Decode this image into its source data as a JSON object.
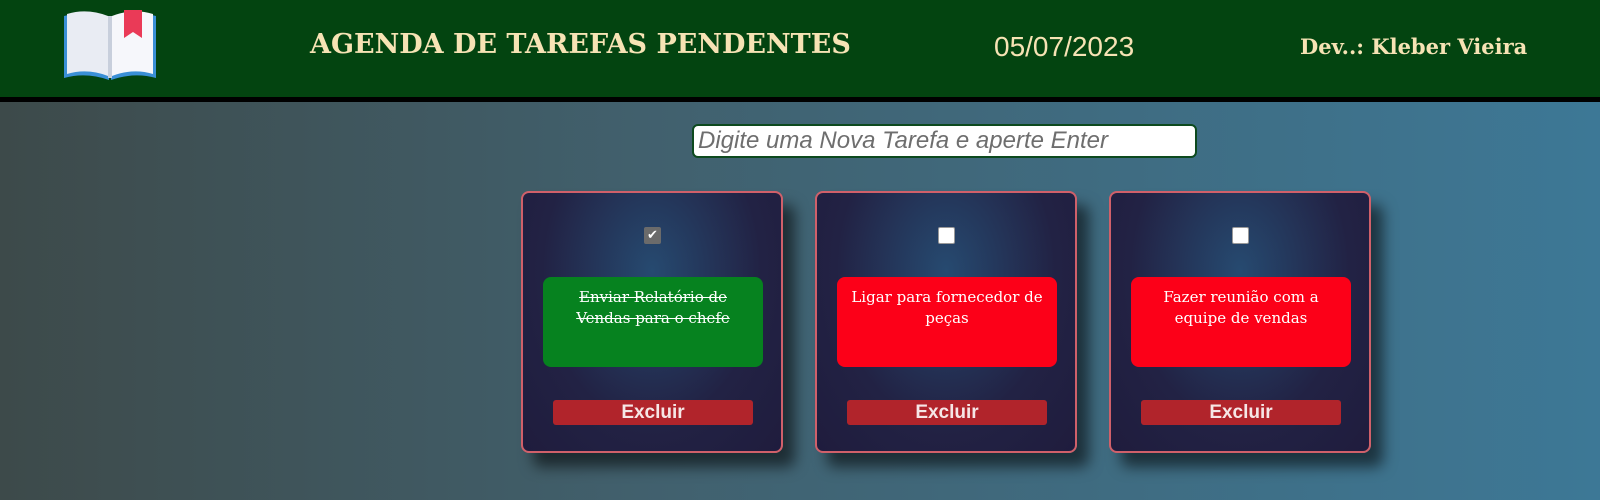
{
  "header": {
    "logo_icon": "open-book-icon",
    "title": "AGENDA DE TAREFAS PENDENTES",
    "date": "05/07/2023",
    "developer": "Dev..: Kleber Vieira"
  },
  "input": {
    "placeholder": "Digite uma Nova Tarefa e aperte Enter",
    "value": ""
  },
  "tasks": [
    {
      "text": "Enviar Relatório de Vendas para o chefe",
      "checked": true,
      "status_color": "#06821f",
      "delete_label": "Excluir"
    },
    {
      "text": "Ligar para fornecedor de peças",
      "checked": false,
      "status_color": "#fc0018",
      "delete_label": "Excluir"
    },
    {
      "text": "Fazer reunião com a equipe de vendas",
      "checked": false,
      "status_color": "#fc0018",
      "delete_label": "Excluir"
    }
  ],
  "colors": {
    "header_bg": "#034410",
    "header_text": "#f6e3b4",
    "card_border": "#d0606a",
    "done": "#06821f",
    "pending": "#fc0018",
    "delete_button": "#b1242b"
  }
}
